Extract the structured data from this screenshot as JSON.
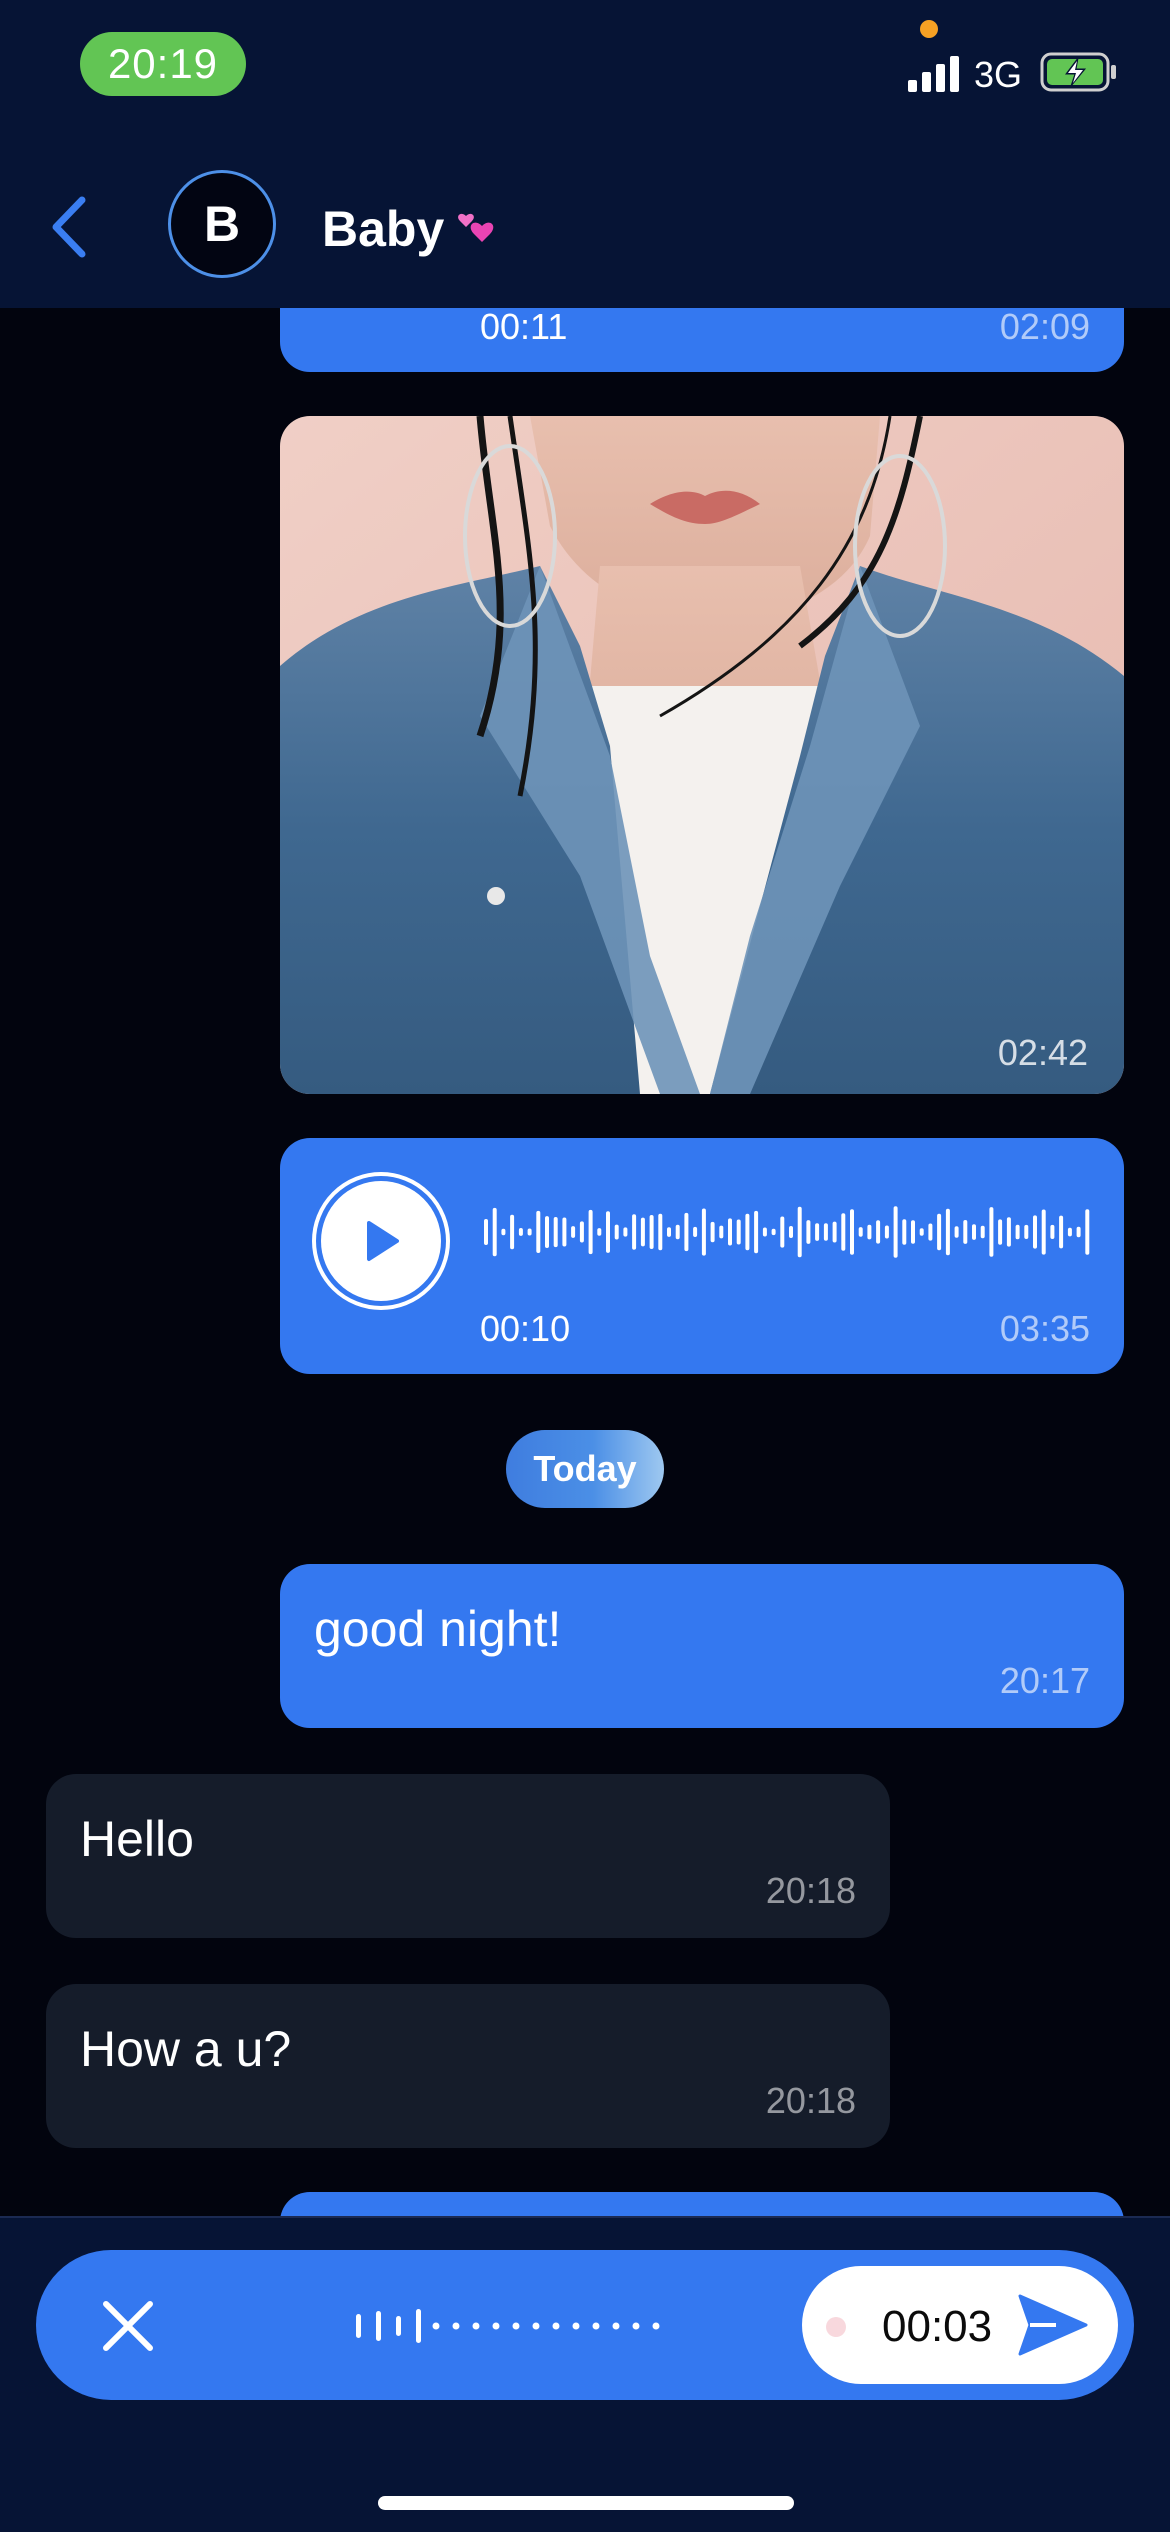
{
  "status_bar": {
    "time": "20:19",
    "network": "3G",
    "icons": [
      "signal-icon",
      "battery-charging-icon"
    ],
    "time_pill_color": "#62c554"
  },
  "header": {
    "back_icon": "chevron-left-icon",
    "avatar_initial": "B",
    "contact_name": "Baby",
    "name_emoji_icon": "two-hearts-icon"
  },
  "messages": {
    "voice_top": {
      "elapsed": "00:11",
      "timestamp": "02:09"
    },
    "photo": {
      "timestamp": "02:42"
    },
    "voice": {
      "elapsed": "00:10",
      "timestamp": "03:35",
      "icon": "play-icon"
    },
    "date_separator": "Today",
    "text_out": {
      "text": "good night!",
      "timestamp": "20:17"
    },
    "text_in_1": {
      "text": "Hello",
      "timestamp": "20:18"
    },
    "text_in_2": {
      "text": "How a u?",
      "timestamp": "20:18"
    }
  },
  "recorder": {
    "cancel_icon": "close-icon",
    "timer": "00:03",
    "send_icon": "send-icon"
  },
  "colors": {
    "background": "#02040e",
    "header": "#061435",
    "outgoing_bubble": "#3478f0",
    "incoming_bubble": "#151c2a"
  }
}
